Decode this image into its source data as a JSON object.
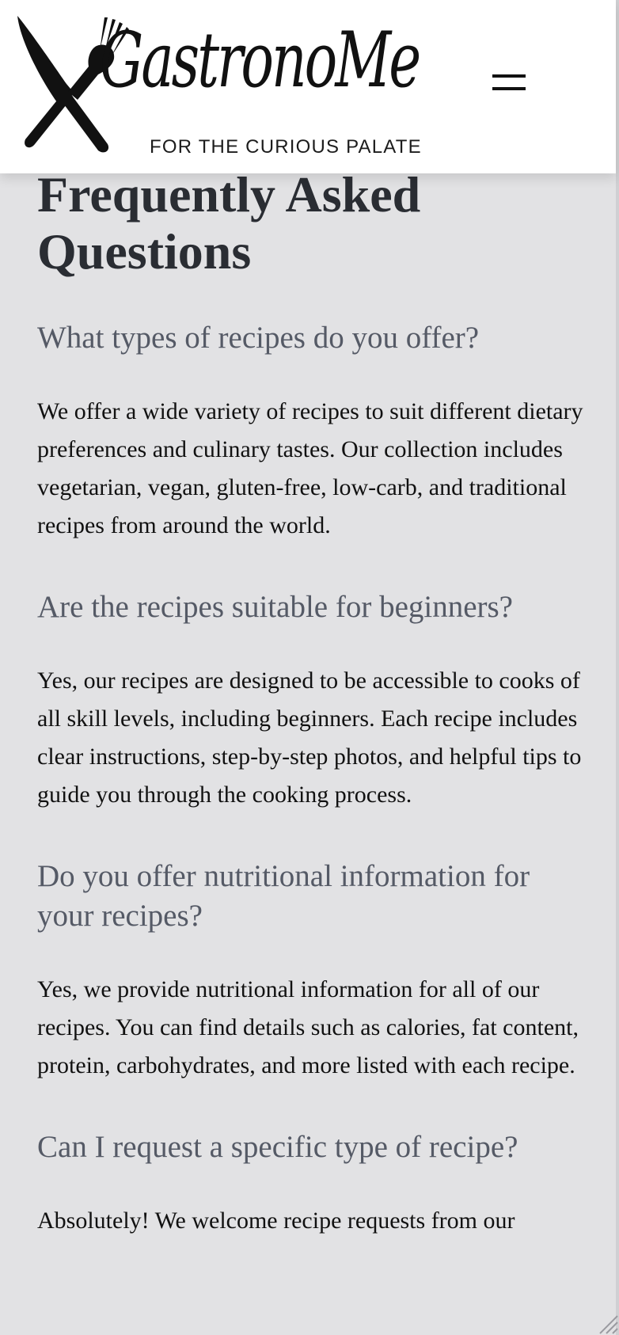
{
  "header": {
    "logo_word": "GastronoMe",
    "logo_tagline": "FOR THE CURIOUS PALATE",
    "logo_icon": "fork-knife-icon",
    "menu_icon": "hamburger-menu-icon"
  },
  "main": {
    "title": "Frequently Asked Questions",
    "faqs": [
      {
        "question": "What types of recipes do you offer?",
        "answer": "We offer a wide variety of recipes to suit different dietary preferences and culinary tastes. Our collection includes vegetarian, vegan, gluten-free, low-carb, and traditional recipes from around the world."
      },
      {
        "question": "Are the recipes suitable for beginners?",
        "answer": "Yes, our recipes are designed to be accessible to cooks of all skill levels, including beginners. Each recipe includes clear instructions, step-by-step photos, and helpful tips to guide you through the cooking process."
      },
      {
        "question": "Do you offer nutritional information for your recipes?",
        "answer": "Yes, we provide nutritional information for all of our recipes. You can find details such as calories, fat content, protein, carbohydrates, and more listed with each recipe."
      },
      {
        "question": "Can I request a specific type of recipe?",
        "answer": "Absolutely! We welcome recipe requests from our"
      }
    ]
  },
  "colors": {
    "page_background": "#e2e2e4",
    "header_background": "#ffffff",
    "title_color": "#2a2d33",
    "question_color": "#555a66",
    "answer_color": "#111111"
  }
}
